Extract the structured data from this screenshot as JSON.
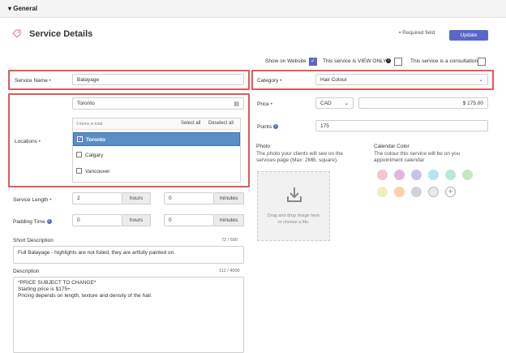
{
  "section": {
    "title": "General"
  },
  "header": {
    "title": "Service Details",
    "required_note": "Required field",
    "update_label": "Update"
  },
  "options": {
    "show_on_website": "Show on Website",
    "view_only": "This service is VIEW ONLY",
    "consultation": "This service is a consultation"
  },
  "form": {
    "service_name_label": "Service Name",
    "service_name_value": "Balayage",
    "category_label": "Category",
    "category_value": "Hair Colour",
    "locations_label": "Locations",
    "locations_search": "Toronto",
    "locations_count": "3 items in total",
    "select_all": "Select all",
    "deselect_all": "Deselect all",
    "locations": [
      {
        "name": "Toronto",
        "checked": true
      },
      {
        "name": "Calgary",
        "checked": false
      },
      {
        "name": "Vancouver",
        "checked": false
      }
    ],
    "price_label": "Price",
    "currency": "CAD",
    "price_value": "$ 175.00",
    "points_label": "Points",
    "points_value": "175",
    "service_length_label": "Service Length",
    "service_length_hours": "2",
    "service_length_minutes": "0",
    "padding_time_label": "Padding Time",
    "padding_hours": "0",
    "padding_minutes": "0",
    "hours_unit": "hours",
    "minutes_unit": "minutes",
    "short_desc_label": "Short Description",
    "short_desc_count": "72 / 500",
    "short_desc_value": "Full Balayage - highlights are not foiled, they are artfully painted on.",
    "desc_label": "Description",
    "desc_count": "112 / 4000",
    "desc_lines": [
      "*PRICE SUBJECT TO CHANGE*",
      "Starting price is $175+.",
      "Pricing depends on length, texture and density of the hair."
    ]
  },
  "photo": {
    "title": "Photo",
    "hint": "The photo your clients will see on the services page (Max: 2MB, square).",
    "drop_line1": "Drag and drop image here",
    "drop_line2": "or choose a file."
  },
  "calendar": {
    "title": "Calendar Color",
    "hint": "The colour this service will be on you appointment calendar",
    "swatches": [
      "#f7c4cc",
      "#e3b4e6",
      "#c8c2ee",
      "#b5e4f3",
      "#b7eadb",
      "#c6e7c0",
      "#eef0b8",
      "#f9d2a9",
      "#cfd2d8",
      "#e8e8e8"
    ]
  },
  "colors": {
    "accent": "#5a66c8",
    "highlight": "#e05a5a",
    "selected": "#5a8fc6"
  }
}
